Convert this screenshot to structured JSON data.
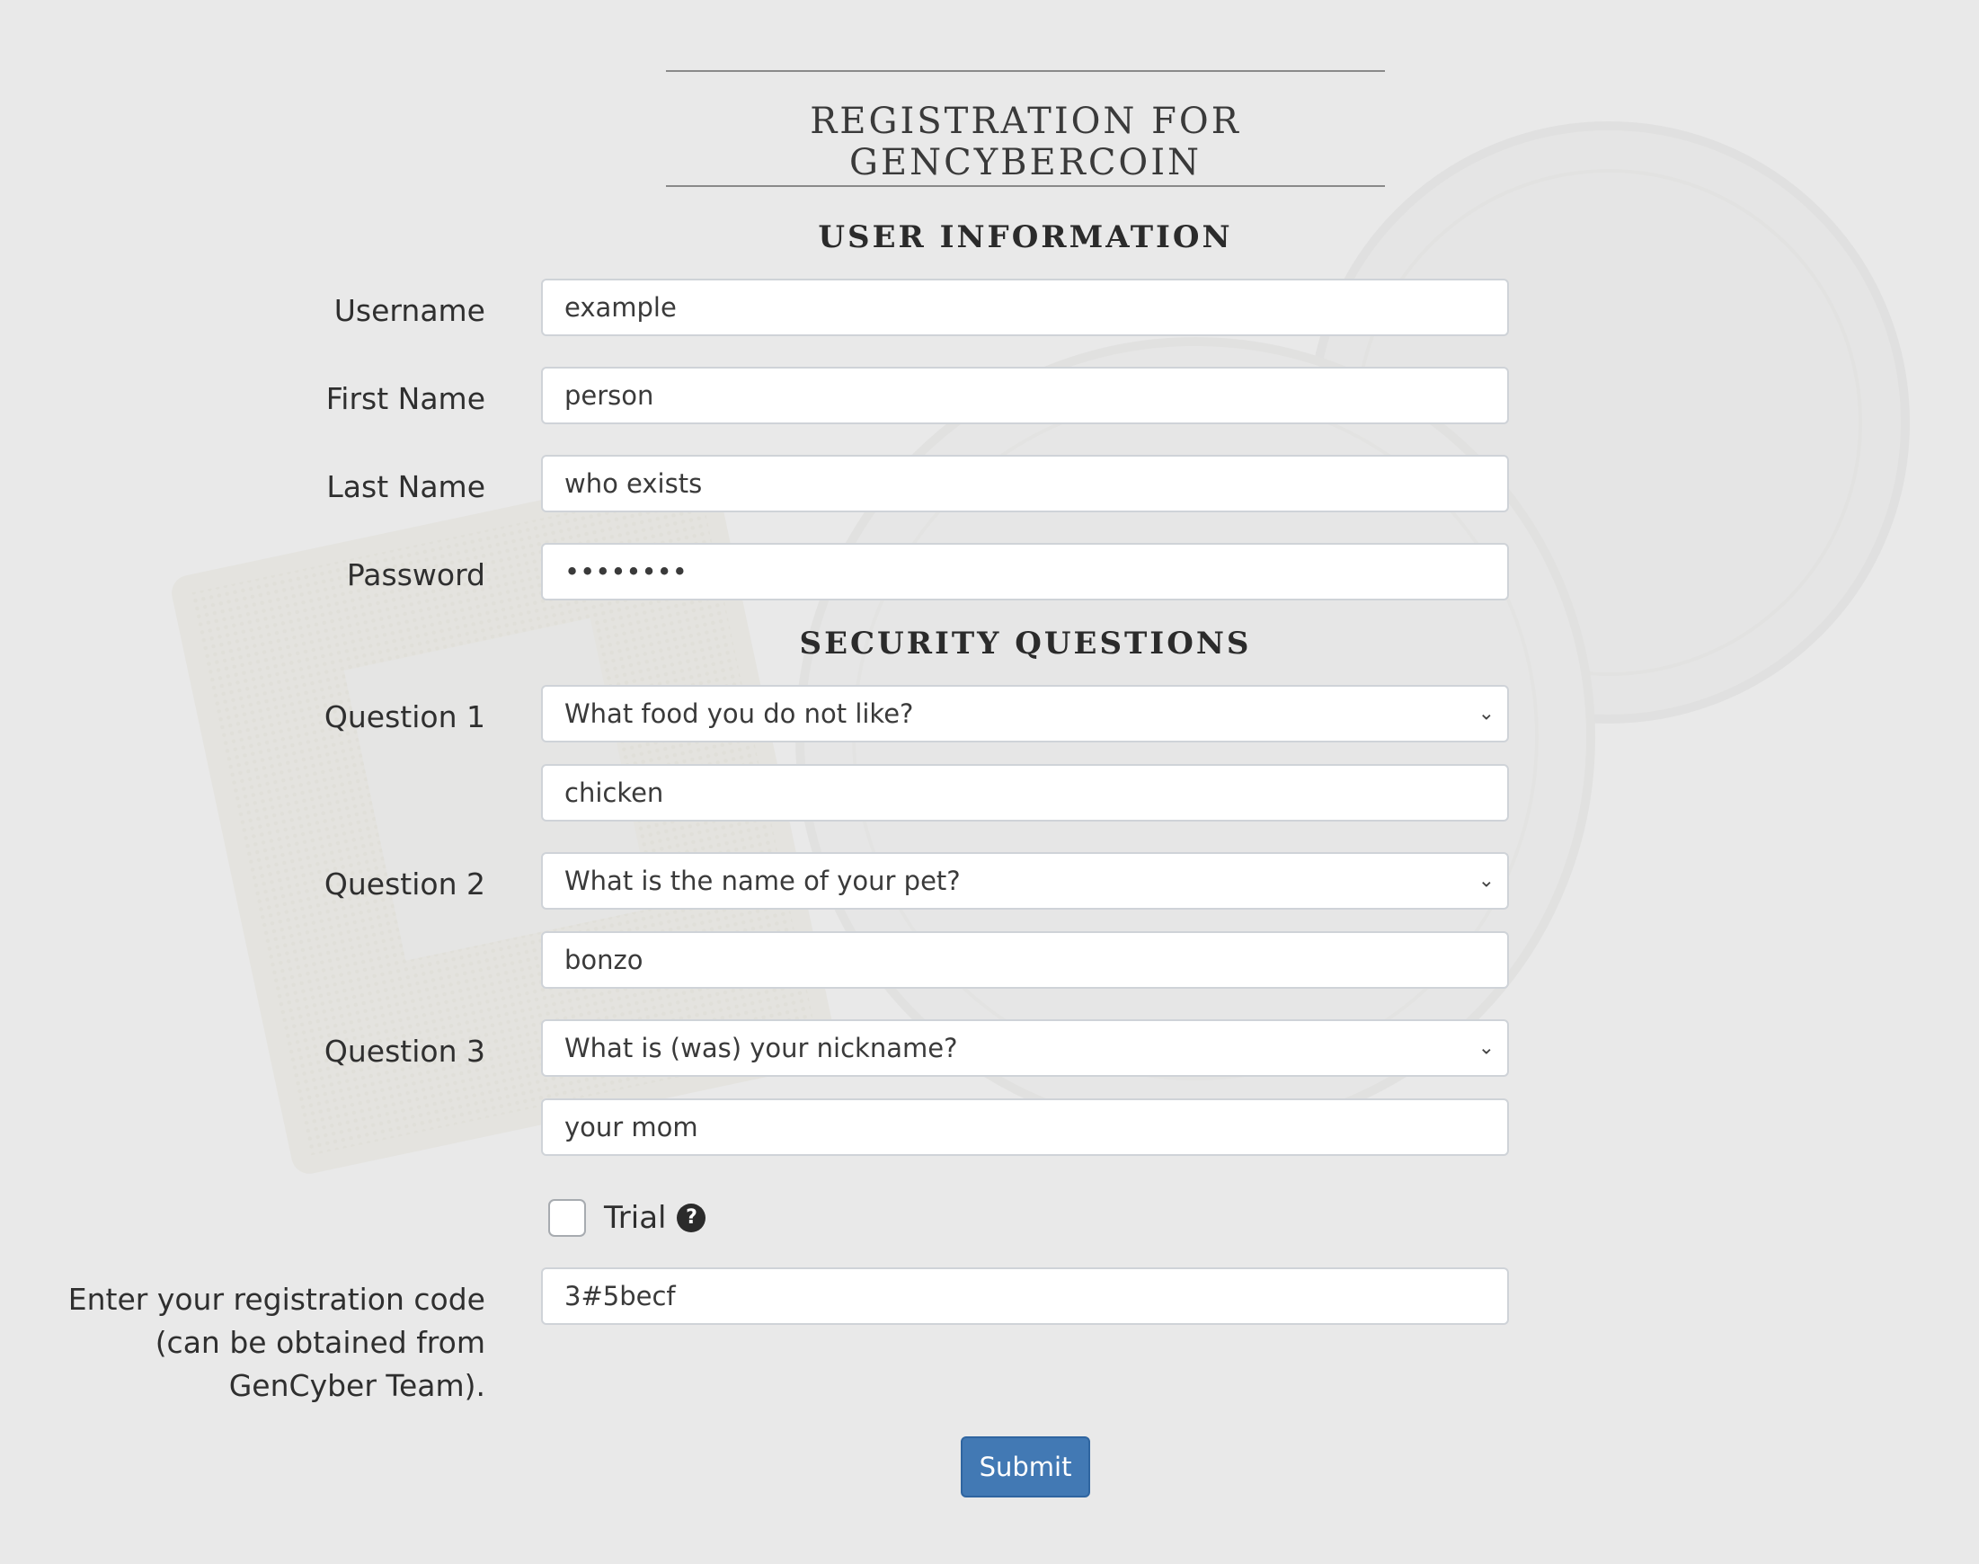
{
  "page": {
    "title": "REGISTRATION FOR GENCYBERCOIN"
  },
  "sections": {
    "user_info": "USER INFORMATION",
    "security": "SECURITY QUESTIONS"
  },
  "user_info": {
    "username": {
      "label": "Username",
      "value": "example"
    },
    "first_name": {
      "label": "First Name",
      "value": "person"
    },
    "last_name": {
      "label": "Last Name",
      "value": "who exists"
    },
    "password": {
      "label": "Password",
      "value": "••••••••"
    }
  },
  "security": {
    "q1": {
      "label": "Question 1",
      "selected": "What food you do not like?",
      "answer": "chicken"
    },
    "q2": {
      "label": "Question 2",
      "selected": "What is the name of your pet?",
      "answer": "bonzo"
    },
    "q3": {
      "label": "Question 3",
      "selected": "What is (was) your nickname?",
      "answer": "your mom"
    }
  },
  "trial": {
    "label": "Trial",
    "checked": false,
    "help_icon": "question-circle-icon"
  },
  "registration": {
    "label_lines": [
      "Enter your registration code",
      "(can be obtained from",
      "GenCyber Team)."
    ],
    "value": "3#5becf"
  },
  "submit_label": "Submit",
  "colors": {
    "background": "#e8e8e9",
    "submit_button": "#4279b4",
    "text": "#333333"
  }
}
